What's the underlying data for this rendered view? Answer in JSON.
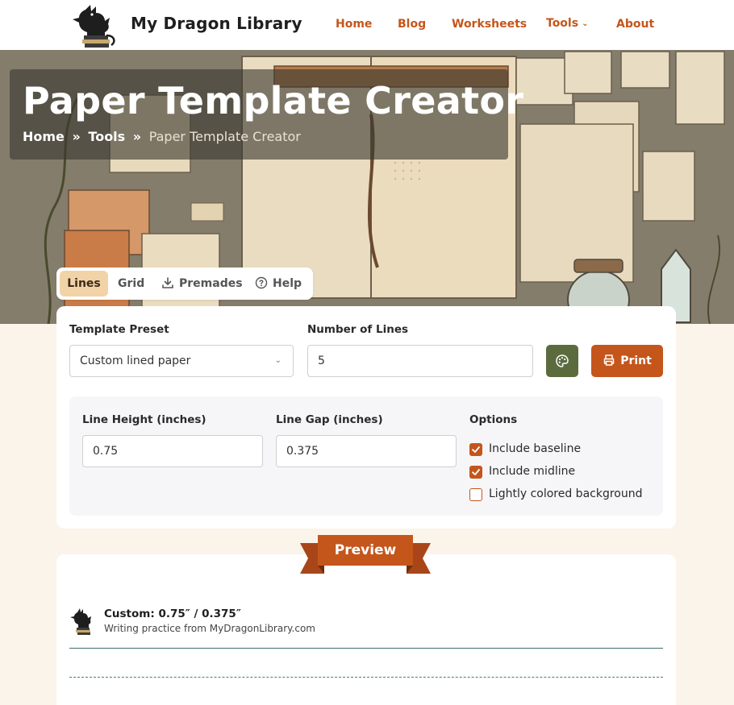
{
  "header": {
    "brand": "My Dragon Library",
    "nav": [
      {
        "label": "Home"
      },
      {
        "label": "Blog"
      },
      {
        "label": "Worksheets"
      },
      {
        "label": "Tools"
      },
      {
        "label": "About"
      }
    ]
  },
  "hero": {
    "title": "Paper Template Creator",
    "breadcrumb": {
      "items": [
        "Home",
        "Tools"
      ],
      "separator": "»",
      "current": "Paper Template Creator"
    }
  },
  "tabs": [
    {
      "label": "Lines",
      "active": true
    },
    {
      "label": "Grid",
      "active": false
    },
    {
      "label": "Premades",
      "active": false,
      "icon": "download-icon"
    },
    {
      "label": "Help",
      "active": false,
      "icon": "help-circle-icon"
    }
  ],
  "settings": {
    "preset_label": "Template Preset",
    "preset_value": "Custom lined paper",
    "lines_label": "Number of Lines",
    "lines_value": "5",
    "palette_icon": "palette-icon",
    "print_label": "Print",
    "line_height_label": "Line Height (inches)",
    "line_height_value": "0.75",
    "line_gap_label": "Line Gap (inches)",
    "line_gap_value": "0.375",
    "options_label": "Options",
    "options": [
      {
        "label": "Include baseline",
        "checked": true
      },
      {
        "label": "Include midline",
        "checked": true
      },
      {
        "label": "Lightly colored background",
        "checked": false
      }
    ]
  },
  "preview": {
    "ribbon_label": "Preview",
    "title": "Custom: 0.75″ / 0.375″",
    "subtitle": "Writing practice from MyDragonLibrary.com"
  },
  "colors": {
    "accent": "#c4561b",
    "olive": "#5b6b3e",
    "tab_active_bg": "#f2d3a8",
    "page_bg": "#fbf4ea",
    "line_color": "#3f6f6f"
  }
}
